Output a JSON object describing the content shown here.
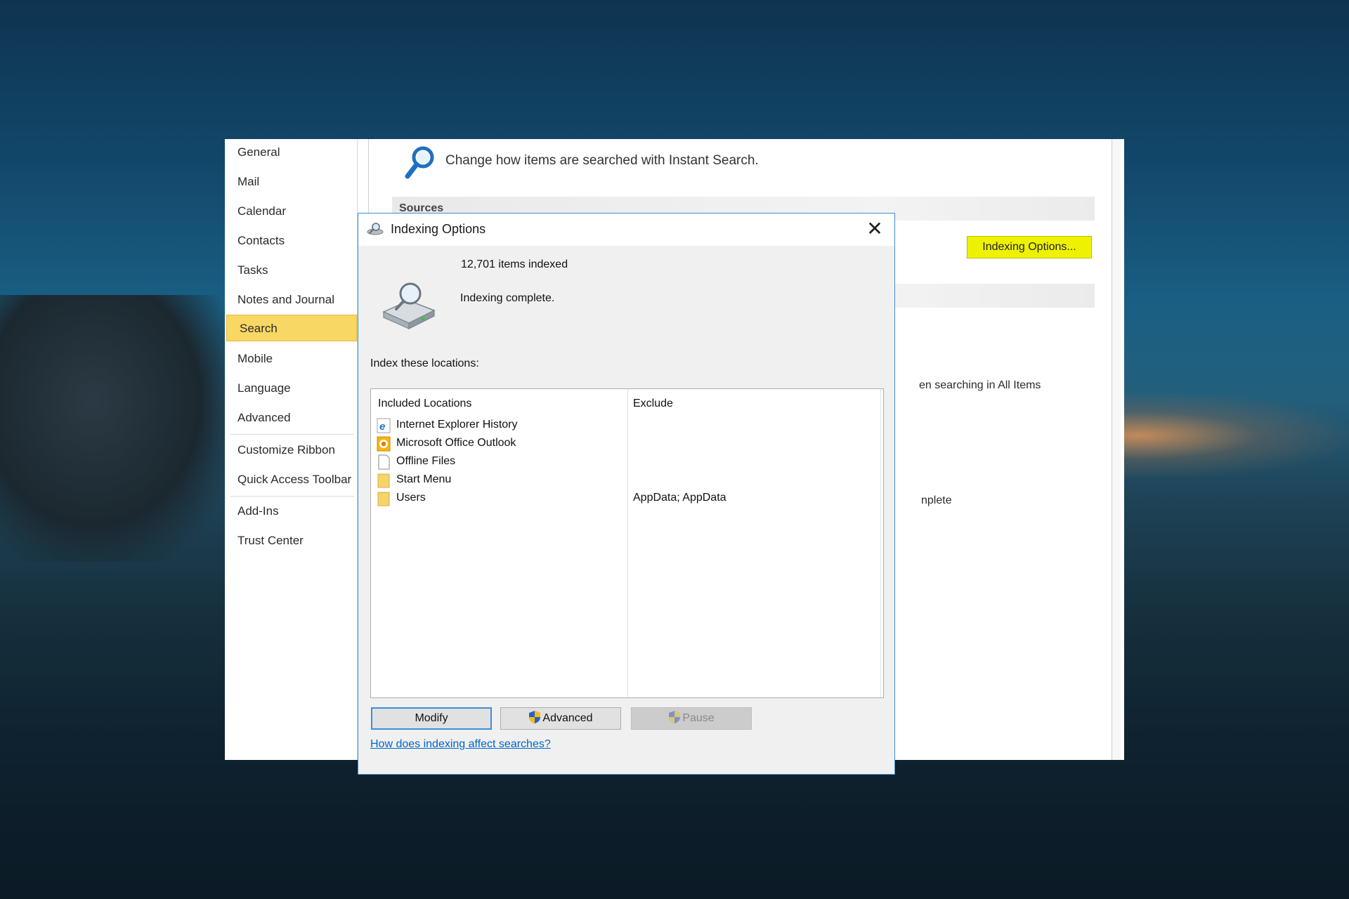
{
  "options": {
    "nav": [
      {
        "label": "General"
      },
      {
        "label": "Mail"
      },
      {
        "label": "Calendar"
      },
      {
        "label": "Contacts"
      },
      {
        "label": "Tasks"
      },
      {
        "label": "Notes and Journal"
      },
      {
        "label": "Search",
        "selected": true
      },
      {
        "label": "Mobile"
      },
      {
        "label": "Language"
      },
      {
        "label": "Advanced"
      },
      {
        "label": "Customize Ribbon"
      },
      {
        "label": "Quick Access Toolbar"
      },
      {
        "label": "Add-Ins"
      },
      {
        "label": "Trust Center"
      }
    ],
    "heading": "Change how items are searched with Instant Search.",
    "sources_label": "Sources",
    "indexing_button": "Indexing Options...",
    "partial_all_items": "en searching in All Items",
    "partial_complete": "nplete"
  },
  "dialog": {
    "title": "Indexing Options",
    "items_indexed": "12,701 items indexed",
    "status": "Indexing complete.",
    "locations_label": "Index these locations:",
    "columns": {
      "included": "Included Locations",
      "exclude": "Exclude"
    },
    "locations": [
      {
        "name": "Internet Explorer History",
        "icon": "ie-icon",
        "exclude": ""
      },
      {
        "name": "Microsoft Office Outlook",
        "icon": "outlook-icon",
        "exclude": ""
      },
      {
        "name": "Offline Files",
        "icon": "file-icon",
        "exclude": ""
      },
      {
        "name": "Start Menu",
        "icon": "folder-icon",
        "exclude": ""
      },
      {
        "name": "Users",
        "icon": "folder-icon",
        "exclude": "AppData; AppData"
      }
    ],
    "buttons": {
      "modify": "Modify",
      "advanced": "Advanced",
      "pause": "Pause"
    },
    "help_link": "How does indexing affect searches?"
  },
  "colors": {
    "selected_nav": "#f8d765",
    "highlight": "#eef200",
    "dialog_border": "#3b8fd8",
    "link": "#0066cc"
  }
}
